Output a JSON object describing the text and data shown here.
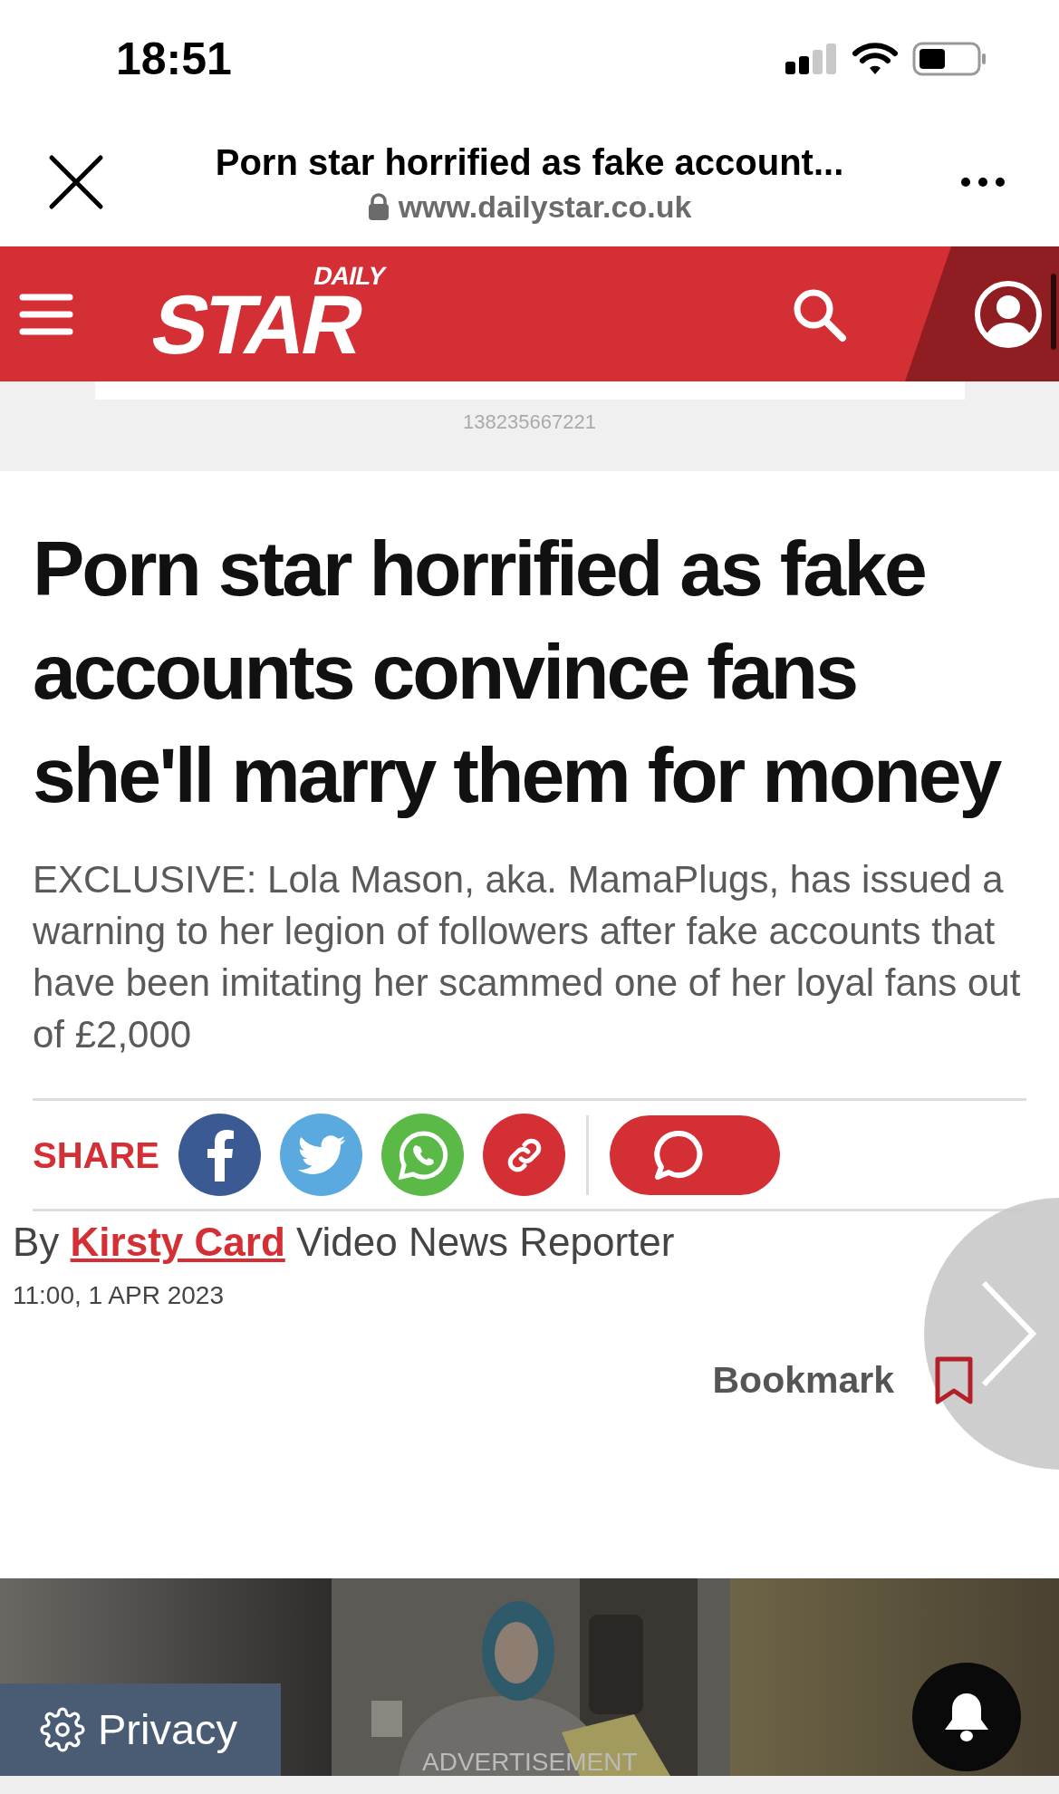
{
  "status_bar": {
    "time": "18:51"
  },
  "browser": {
    "title": "Porn star horrified as fake account...",
    "url": "www.dailystar.co.uk"
  },
  "header": {
    "logo": {
      "small": "DAILY",
      "big": "STAR"
    }
  },
  "ad_banner": {
    "id": "138235667221"
  },
  "article": {
    "headline": "Porn star horrified as fake accounts convince fans she'll marry them for money",
    "standfirst": "EXCLUSIVE: Lola Mason, aka. MamaPlugs, has issued a warning to her legion of followers after fake accounts that have been imitating her scammed one of her loyal fans out of £2,000",
    "share": {
      "label": "SHARE",
      "buttons": [
        {
          "kind": "facebook"
        },
        {
          "kind": "twitter"
        },
        {
          "kind": "whatsapp"
        },
        {
          "kind": "link"
        }
      ]
    },
    "byline": {
      "prefix": "By",
      "author": "Kirsty Card",
      "role": "Video News Reporter"
    },
    "date": "11:00, 1 APR 2023",
    "bookmark": {
      "label": "Bookmark"
    }
  },
  "video_ad": {
    "privacy": "Privacy",
    "label": "ADVERTISEMENT"
  }
}
